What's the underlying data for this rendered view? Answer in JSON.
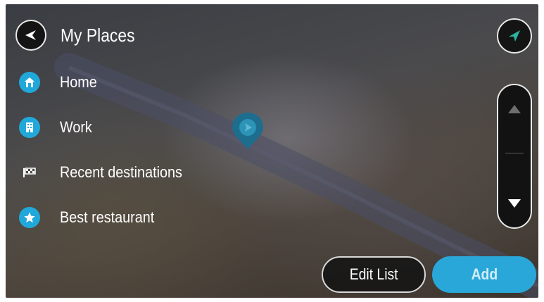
{
  "header": {
    "title": "My Places",
    "back_icon": "back-arrow-icon",
    "compass_icon": "compass-arrow-icon"
  },
  "places": [
    {
      "label": "Home",
      "icon": "home-icon"
    },
    {
      "label": "Work",
      "icon": "work-building-icon"
    },
    {
      "label": "Recent destinations",
      "icon": "recent-destinations-flag-icon"
    },
    {
      "label": "Best restaurant",
      "icon": "star-icon"
    }
  ],
  "buttons": {
    "edit_list": "Edit List",
    "add": "Add"
  },
  "colors": {
    "accent": "#21a8da",
    "add_button": "#2aa7d9",
    "compass_arrow": "#2bb5a0"
  }
}
